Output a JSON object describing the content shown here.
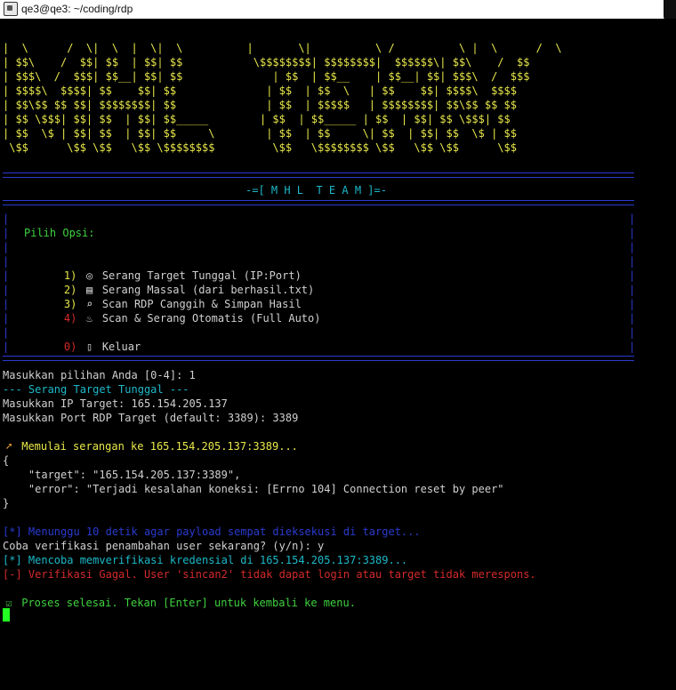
{
  "window": {
    "title": "qe3@qe3: ~/coding/rdp"
  },
  "banner": [
    "|  \\      /  \\|  \\  |  \\|  \\          |       \\|          \\ /          \\ |  \\      /  \\",
    "| $$\\    /  $$| $$  | $$| $$           \\$$$$$$$$| $$$$$$$$|  $$$$$$\\| $$\\    /  $$",
    "| $$$\\  /  $$$| $$__| $$| $$              | $$  | $$__    | $$__| $$| $$$\\  /  $$$",
    "| $$$$\\  $$$$| $$    $$| $$              | $$  | $$  \\   | $$    $$| $$$$\\  $$$$",
    "| $$\\$$ $$ $$| $$$$$$$$| $$              | $$  | $$$$$   | $$$$$$$$| $$\\$$ $$ $$",
    "| $$ \\$$$| $$| $$  | $$| $$_____        | $$  | $$_____ | $$  | $$| $$ \\$$$| $$",
    "| $$  \\$ | $$| $$  | $$| $$     \\        | $$  | $$     \\| $$  | $$| $$  \\$ | $$",
    " \\$$      \\$$ \\$$   \\$$ \\$$$$$$$$         \\$$   \\$$$$$$$$ \\$$   \\$$ \\$$      \\$$"
  ],
  "team_title": "-=[ M H L  T E A M ]=-",
  "menu": {
    "heading": "Pilih Opsi:",
    "items": [
      {
        "num": "1)",
        "icon": "target-icon",
        "glyph": "◎",
        "label": "Serang Target Tunggal (IP:Port)",
        "color": "#e8e84a"
      },
      {
        "num": "2)",
        "icon": "document-icon",
        "glyph": "▤",
        "label": "Serang Massal (dari berhasil.txt)",
        "color": "#e8e84a"
      },
      {
        "num": "3)",
        "icon": "magnifier-icon",
        "glyph": "⌕",
        "label": "Scan RDP Canggih & Simpan Hasil",
        "color": "#e8e84a"
      },
      {
        "num": "4)",
        "icon": "fire-icon",
        "glyph": "♨",
        "label": "Scan & Serang Otomatis (Full Auto)",
        "color": "#d42a2a"
      },
      {
        "num": "0)",
        "icon": "exit-door-icon",
        "glyph": "▯",
        "label": "Keluar",
        "color": "#d42a2a"
      }
    ]
  },
  "session": {
    "choice_prompt": "Masukkan pilihan Anda [0-4]: 1",
    "section_header": "--- Serang Target Tunggal ---",
    "ip_prompt": "Masukkan IP Target: 165.154.205.137",
    "port_prompt": "Masukkan Port RDP Target (default: 3389): 3389",
    "attack_start_icon": "rocket-icon",
    "attack_start": "Memulai serangan ke 165.154.205.137:3389...",
    "json_open": "{",
    "json_target": "    \"target\": \"165.154.205.137:3389\",",
    "json_error": "    \"error\": \"Terjadi kesalahan koneksi: [Errno 104] Connection reset by peer\"",
    "json_close": "}",
    "wait_msg": "[*] Menunggu 10 detik agar payload sempat dieksekusi di target...",
    "verify_prompt": "Coba verifikasi penambahan user sekarang? (y/n): y",
    "verify_attempt": "[*] Mencoba memverifikasi kredensial di 165.154.205.137:3389...",
    "verify_fail": "[-] Verifikasi Gagal. User 'sincan2' tidak dapat login atau target tidak merespons.",
    "done_icon": "checkbox-icon",
    "done_msg": "Proses selesai. Tekan [Enter] untuk kembali ke menu."
  },
  "colors": {
    "banner": "#e8e84a",
    "border": "#2a3bd0",
    "cyan": "#1cb9c9",
    "green": "#3fd23f",
    "red": "#d42a2a",
    "cursor": "#22ff22"
  }
}
